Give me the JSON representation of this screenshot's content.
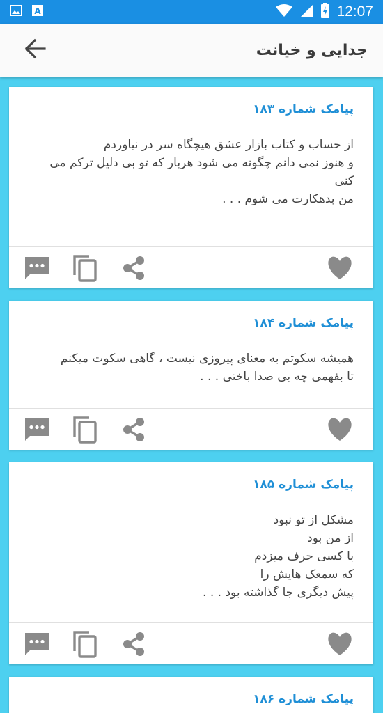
{
  "status_bar": {
    "time": "12:07"
  },
  "app_bar": {
    "title": "جدایی و خیانت"
  },
  "messages": [
    {
      "title": "پیامک شماره ۱۸۳",
      "body": "از حساب و کتاب بازار عشق هیچگاه سر در نیاوردم\nو هنوز نمی دانم چگونه می شود هربار که تو بی دلیل ترکم می کنی\nمن بدهکارت می شوم . . ."
    },
    {
      "title": "پیامک شماره ۱۸۴",
      "body": "همیشه سکوتم به معنای پیروزی نیست ، گاهی سکوت میکنم\nتا بفهمی چه بی صدا باختی . . ."
    },
    {
      "title": "پیامک شماره ۱۸۵",
      "body": "مشکل از تو نبود\nاز من بود\nبا کسی حرف میزدم\nکه سمعک هایش را\nپیش دیگری جا گذاشته بود . . ."
    },
    {
      "title": "پیامک شماره ۱۸۶",
      "body": ""
    }
  ],
  "colors": {
    "accent": "#1a8fe3",
    "title": "#1f8fd6",
    "background": "#4dd0f0",
    "icon": "#8a8a8a"
  },
  "icons": [
    "image-icon",
    "text-icon",
    "wifi-icon",
    "signal-icon",
    "battery-icon",
    "back-arrow-icon",
    "message-icon",
    "copy-icon",
    "share-icon",
    "heart-icon"
  ]
}
